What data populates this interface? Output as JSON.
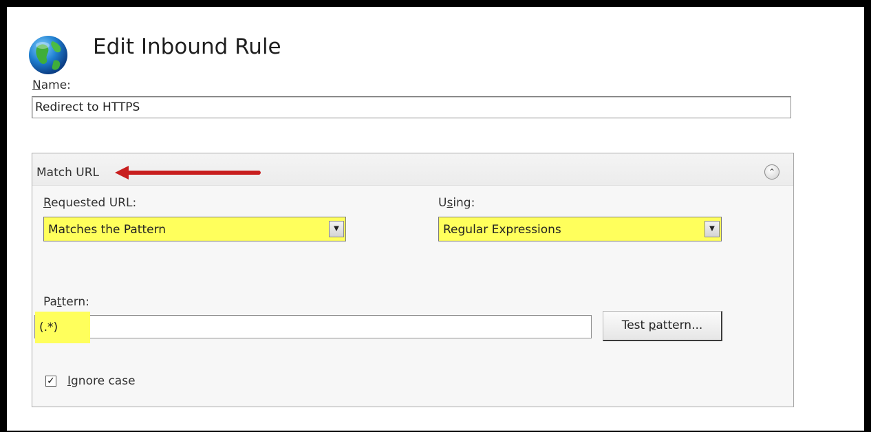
{
  "dialog": {
    "title": "Edit Inbound Rule",
    "name_label_first": "N",
    "name_label_rest": "ame:",
    "name_value": "Redirect to HTTPS"
  },
  "match_url": {
    "header": "Match URL",
    "collapse_icon": "chevron-up-icon",
    "requested_url_label_first": "R",
    "requested_url_label_rest": "equested URL:",
    "requested_url_value": "Matches the Pattern",
    "using_label_a": "U",
    "using_label_s": "s",
    "using_label_rest": "ing:",
    "using_value": "Regular Expressions",
    "pattern_label_a": "Pa",
    "pattern_label_t": "t",
    "pattern_label_rest": "tern:",
    "pattern_value": "(.*)",
    "test_button_a": "Test ",
    "test_button_p": "p",
    "test_button_rest": "attern...",
    "ignore_case_i": "I",
    "ignore_case_rest": "gnore case",
    "ignore_case_checked": true
  },
  "colors": {
    "highlight": "#ffff5c",
    "arrow": "#c81e1e"
  }
}
